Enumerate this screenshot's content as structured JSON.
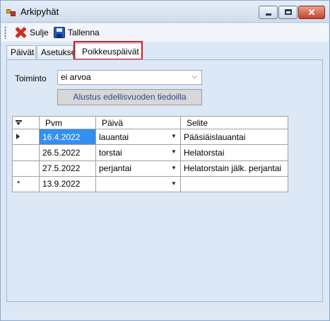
{
  "window": {
    "title": "Arkipyhät"
  },
  "toolbar": {
    "close_label": "Sulje",
    "save_label": "Tallenna"
  },
  "tabs": [
    {
      "label": "Päivät",
      "active": false
    },
    {
      "label": "Asetukset",
      "active": false
    },
    {
      "label": "Poikkeuspäivät",
      "active": true
    }
  ],
  "form": {
    "action_label": "Toiminto",
    "action_value": "ei arvoa",
    "init_button_label": "Alustus edellisvuoden tiedoilla"
  },
  "grid": {
    "columns": [
      "Pvm",
      "Päivä",
      "Selite"
    ],
    "rows": [
      {
        "pvm": "16.4.2022",
        "paiva": "lauantai",
        "selite": "Pääsiäislauantai"
      },
      {
        "pvm": "26.5.2022",
        "paiva": "torstai",
        "selite": "Helatorstai"
      },
      {
        "pvm": "27.5.2022",
        "paiva": "perjantai",
        "selite": "Helatorstain jälk. perjantai"
      }
    ],
    "new_row": {
      "pvm": "13.9.2022",
      "paiva": "",
      "selite": "",
      "marker": "*"
    }
  },
  "colors": {
    "selection": "#3290f0",
    "highlight": "#e0141a",
    "panel": "#dde8f6"
  }
}
